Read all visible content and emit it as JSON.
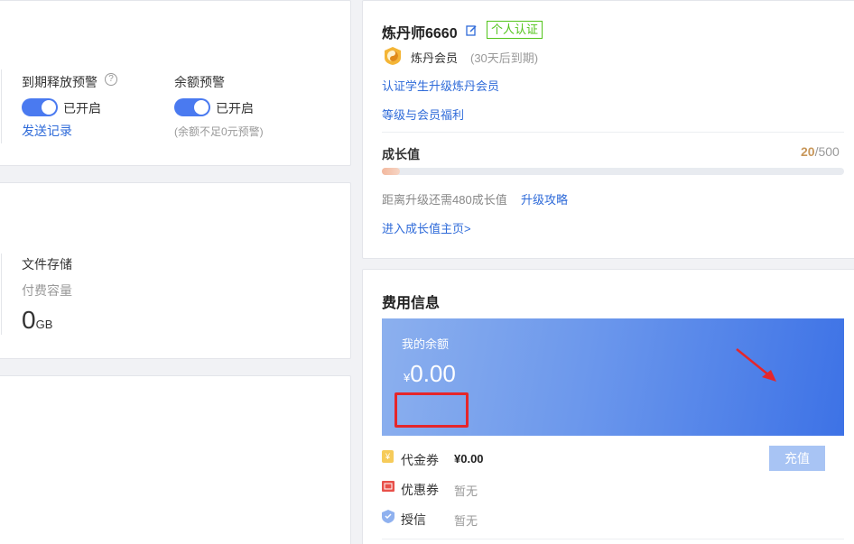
{
  "alerts": {
    "expiry_label": "到期释放预警",
    "expiry_status": "已开启",
    "send_record": "发送记录",
    "balance_label": "余额预警",
    "balance_status": "已开启",
    "balance_note": "(余额不足0元预警)",
    "help_glyph": "?"
  },
  "storage": {
    "title": "文件存储",
    "sub": "付费容量",
    "value": "0",
    "unit": "GB"
  },
  "profile": {
    "username": "炼丹师6660",
    "badge": "个人认证",
    "member_name": "炼丹会员",
    "member_expiry": "(30天后到期)",
    "link_student": "认证学生升级炼丹会员",
    "link_benefits": "等级与会员福利",
    "growth_label": "成长值",
    "growth_current": "20",
    "growth_max": "/500",
    "growth_progress": 0.04,
    "growth_hint": "距离升级还需480成长值",
    "upgrade_link": "升级攻略",
    "growth_home": "进入成长值主页>"
  },
  "fee": {
    "title": "费用信息",
    "balance_label": "我的余额",
    "currency": "¥",
    "balance_value": "0.00",
    "recharge": "充值",
    "voucher_label": "代金券",
    "voucher_value": "¥0.00",
    "coupon_label": "优惠券",
    "coupon_value": "暂无",
    "credit_label": "授信",
    "credit_value": "暂无"
  },
  "colors": {
    "accent": "#4a7af0",
    "link": "#2f6bd9",
    "badge_green": "#52c41a",
    "annotation_red": "#e5262b",
    "growth_orange": "#c8975a"
  }
}
